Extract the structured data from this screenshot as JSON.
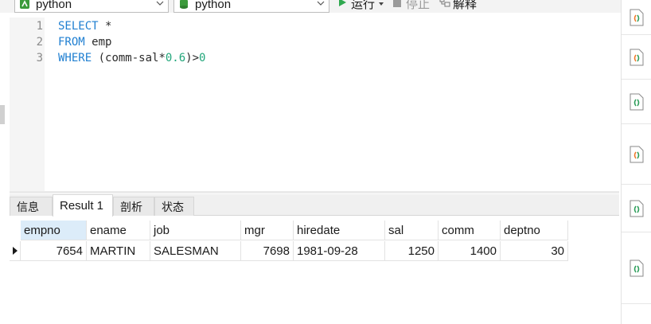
{
  "toolbar": {
    "connection_combo": {
      "value": "python",
      "icon": "connection-icon"
    },
    "database_combo": {
      "value": "python",
      "icon": "database-icon"
    },
    "run_label": "运行",
    "stop_label": "停止",
    "explain_label": "解释"
  },
  "editor": {
    "lines": [
      {
        "number": "1",
        "keyword": "SELECT",
        "rest": " *"
      },
      {
        "number": "2",
        "keyword": "FROM",
        "rest": " emp"
      },
      {
        "number": "3",
        "keyword": "WHERE",
        "rest": " (comm-sal*",
        "number_literal": "0.6",
        "rest2": ")>",
        "number_literal2": "0"
      }
    ]
  },
  "result_tabs": [
    {
      "label": "信息"
    },
    {
      "label": "Result 1",
      "active": true
    },
    {
      "label": "剖析"
    },
    {
      "label": "状态"
    }
  ],
  "grid": {
    "columns": [
      "empno",
      "ename",
      "job",
      "mgr",
      "hiredate",
      "sal",
      "comm",
      "deptno"
    ],
    "selected_column": "empno",
    "rows": [
      [
        "7654",
        "MARTIN",
        "SALESMAN",
        "7698",
        "1981-09-28",
        "1250",
        "1400",
        "30"
      ]
    ]
  },
  "right_panel": {
    "items": [
      {
        "icon": "sql-file-icon"
      },
      {
        "icon": "sql-file-icon"
      },
      {
        "icon": "sql-file-icon"
      },
      {
        "icon": "sql-file-icon"
      },
      {
        "icon": "sql-file-icon"
      },
      {
        "icon": "sql-file-icon"
      }
    ]
  },
  "colors": {
    "keyword": "#1f7fd1",
    "number": "#21a67a",
    "run_icon": "#2fa84f",
    "connection_icon": "#3b9a3b",
    "database_icon": "#3b9a3b",
    "selected_header": "#dcecf9",
    "file_icon_orange": "#f07a2a",
    "file_icon_green": "#2e9e5b"
  }
}
